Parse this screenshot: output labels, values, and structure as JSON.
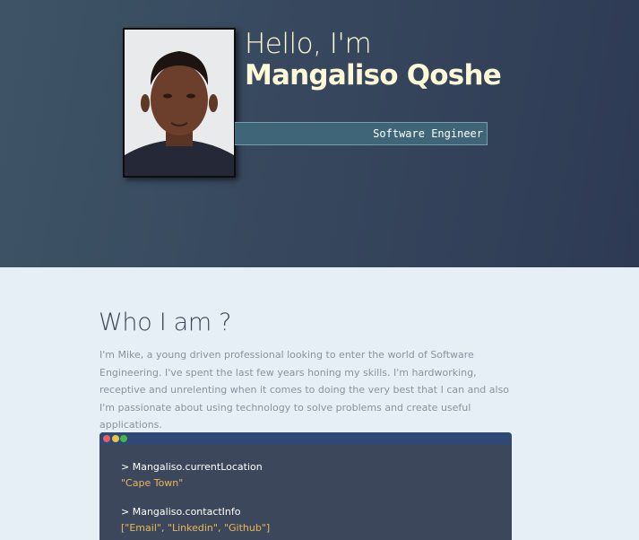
{
  "hero": {
    "greeting": "Hello, I'm",
    "name": "Mangaliso Qoshe",
    "role": "Software Engineer",
    "avatar_icon": "profile-photo"
  },
  "about": {
    "title": "Who I am ?",
    "text": "I'm Mike, a young driven professional looking to enter the world of Software Engineering. I've spent the last few years honing my skills. I'm hardworking, receptive and unrelenting when it comes to doing the very best that I can and also I'm passionate about using technology to solve problems and create useful applications."
  },
  "terminal": {
    "lines": [
      {
        "command": "> Mangaliso.currentLocation",
        "output": "\"Cape Town\""
      },
      {
        "command": "> Mangaliso.contactInfo",
        "output": "[\"Email\", \"Linkedin\", \"Github\"]"
      }
    ],
    "colors": {
      "red": "#e95f5f",
      "yellow": "#e9c24a",
      "green": "#45b647",
      "output": "#e9b85b"
    }
  }
}
